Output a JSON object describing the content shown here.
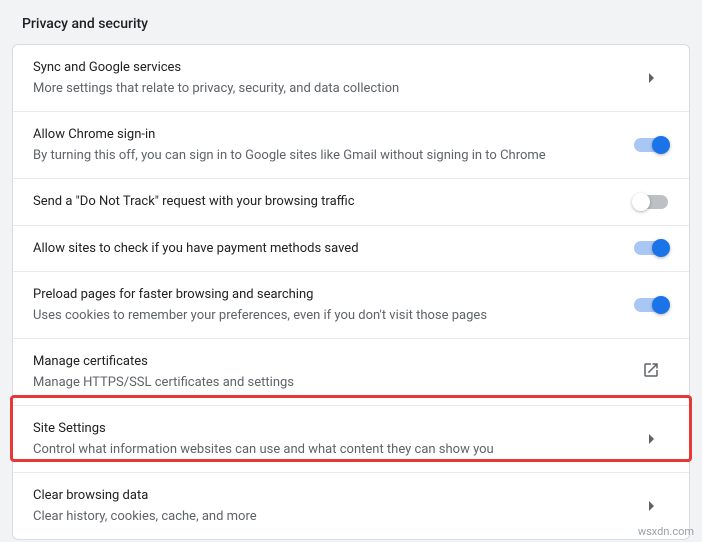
{
  "section_title": "Privacy and security",
  "rows": {
    "sync": {
      "title": "Sync and Google services",
      "subtitle": "More settings that relate to privacy, security, and data collection"
    },
    "signin": {
      "title": "Allow Chrome sign-in",
      "subtitle": "By turning this off, you can sign in to Google sites like Gmail without signing in to Chrome"
    },
    "dnt": {
      "title": "Send a \"Do Not Track\" request with your browsing traffic"
    },
    "payment": {
      "title": "Allow sites to check if you have payment methods saved"
    },
    "preload": {
      "title": "Preload pages for faster browsing and searching",
      "subtitle": "Uses cookies to remember your preferences, even if you don't visit those pages"
    },
    "certs": {
      "title": "Manage certificates",
      "subtitle": "Manage HTTPS/SSL certificates and settings"
    },
    "site": {
      "title": "Site Settings",
      "subtitle": "Control what information websites can use and what content they can show you"
    },
    "clear": {
      "title": "Clear browsing data",
      "subtitle": "Clear history, cookies, cache, and more"
    }
  },
  "watermark": "wsxdn.com"
}
